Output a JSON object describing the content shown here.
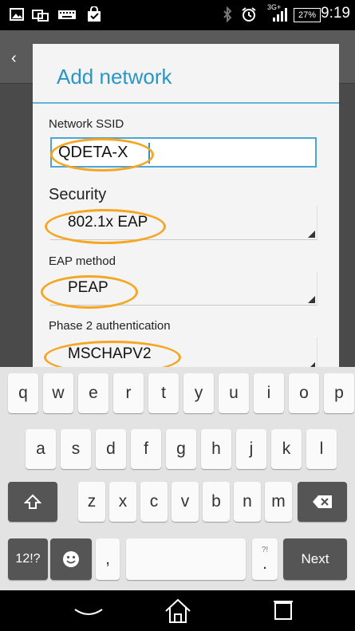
{
  "status_bar": {
    "time": "9:19",
    "battery_percent": "27%",
    "network_type": "3G+",
    "left_icons": [
      "screenshot-icon",
      "usb-icon",
      "keyboard-icon",
      "shopping-bag-icon"
    ],
    "right_icons": [
      "bluetooth-icon",
      "alarm-icon",
      "signal-icon"
    ]
  },
  "background": {
    "back_glyph": "‹"
  },
  "dialog": {
    "title": "Add network",
    "ssid_label": "Network SSID",
    "ssid_value": "QDETA-X",
    "security_label": "Security",
    "security_value": "802.1x EAP",
    "eap_label": "EAP method",
    "eap_value": "PEAP",
    "phase2_label": "Phase 2 authentication",
    "phase2_value": "MSCHAPV2",
    "accent_color": "#2b95c6",
    "highlight_color": "#f5a623"
  },
  "keyboard": {
    "row1": [
      "q",
      "w",
      "e",
      "r",
      "t",
      "y",
      "u",
      "i",
      "o",
      "p"
    ],
    "row2": [
      "a",
      "s",
      "d",
      "f",
      "g",
      "h",
      "j",
      "k",
      "l"
    ],
    "row3": [
      "z",
      "x",
      "c",
      "v",
      "b",
      "n",
      "m"
    ],
    "symbols_label": "12!?",
    "comma": ",",
    "period": ".",
    "period_hint": "?!",
    "next_label": "Next"
  },
  "nav_bar": {
    "buttons": [
      "back-icon",
      "home-icon",
      "recents-icon"
    ]
  }
}
